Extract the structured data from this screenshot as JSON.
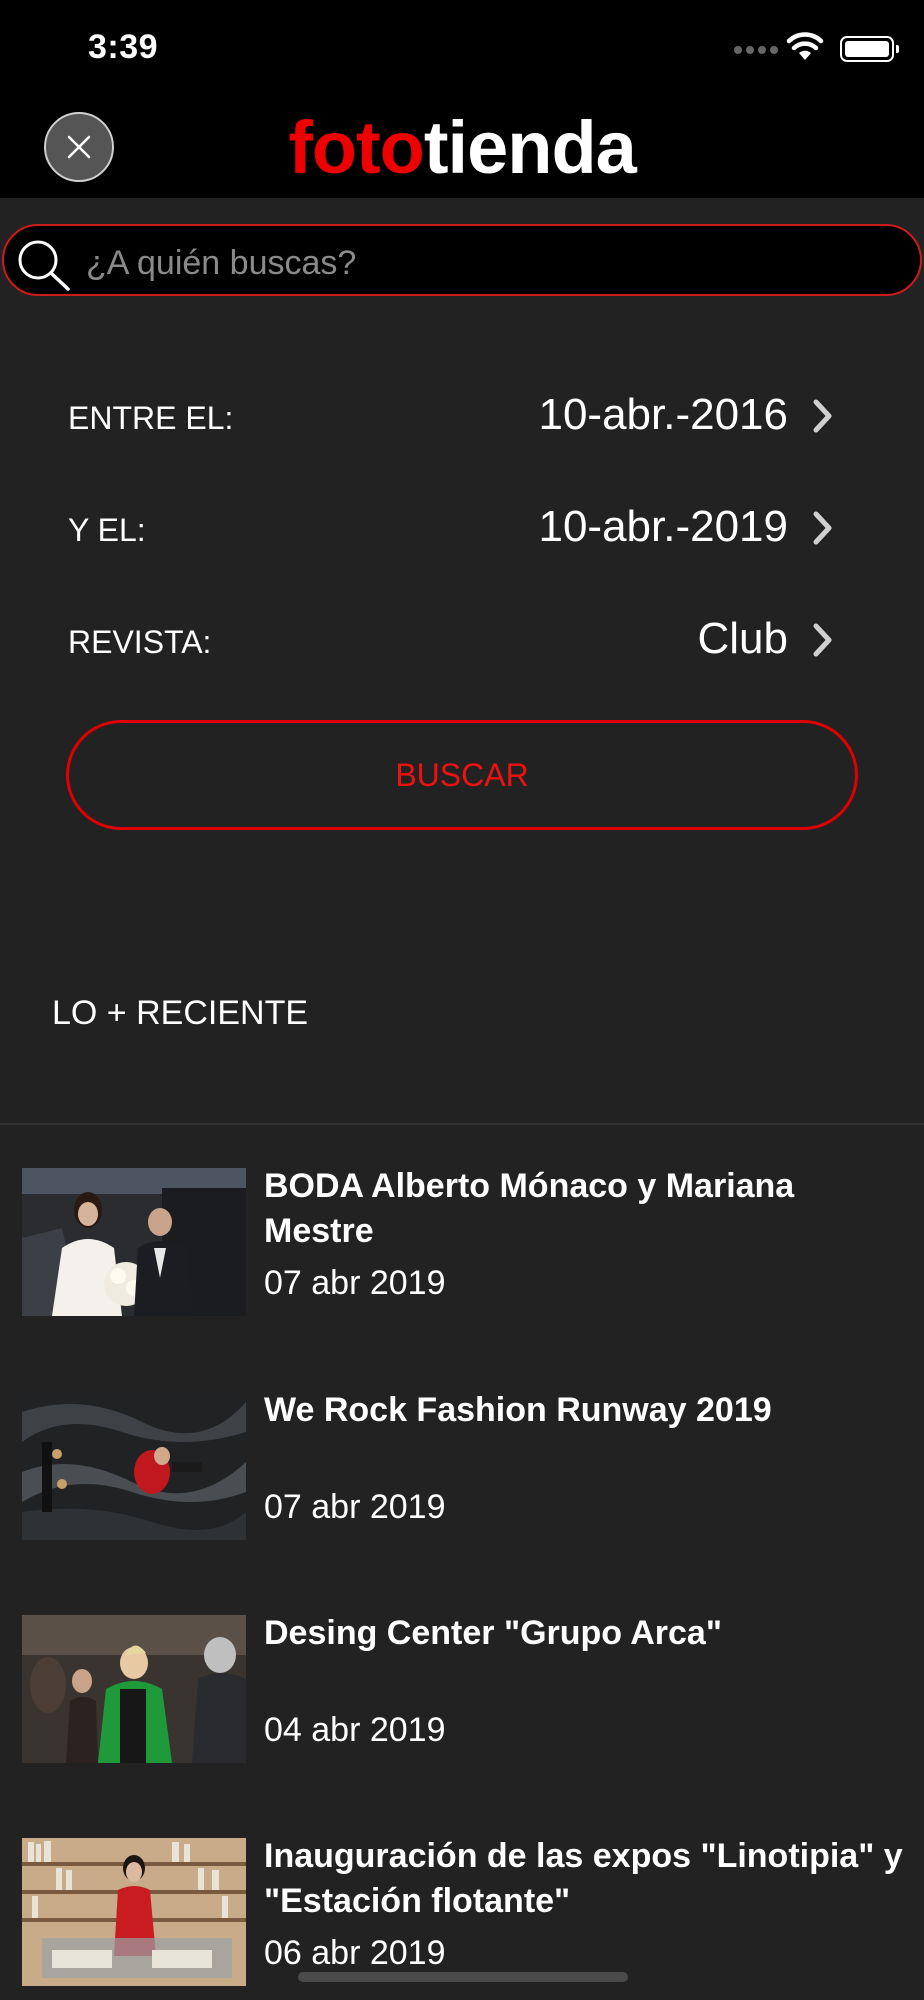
{
  "status_bar": {
    "time": "3:39"
  },
  "header": {
    "logo_part1": "foto",
    "logo_part2": "tienda",
    "close_icon": "close-icon",
    "brand_color": "#ee0000"
  },
  "search": {
    "placeholder": "¿A quién buscas?",
    "icon": "search-icon"
  },
  "filters": [
    {
      "label": "ENTRE EL:",
      "value": "10-abr.-2016"
    },
    {
      "label": "Y EL:",
      "value": "10-abr.-2019"
    },
    {
      "label": "REVISTA:",
      "value": "Club"
    }
  ],
  "search_button": {
    "label": "BUSCAR"
  },
  "recent": {
    "title": "LO + RECIENTE",
    "items": [
      {
        "title": "BODA Alberto Mónaco y Mariana Mestre",
        "date": "07 abr 2019"
      },
      {
        "title": "We Rock Fashion Runway 2019",
        "date": "07 abr 2019"
      },
      {
        "title": "Desing Center \"Grupo Arca\"",
        "date": "04 abr 2019"
      },
      {
        "title": "Inauguración de las expos \"Linotipia\" y \"Estación flotante\"",
        "date": "06 abr 2019"
      }
    ]
  }
}
